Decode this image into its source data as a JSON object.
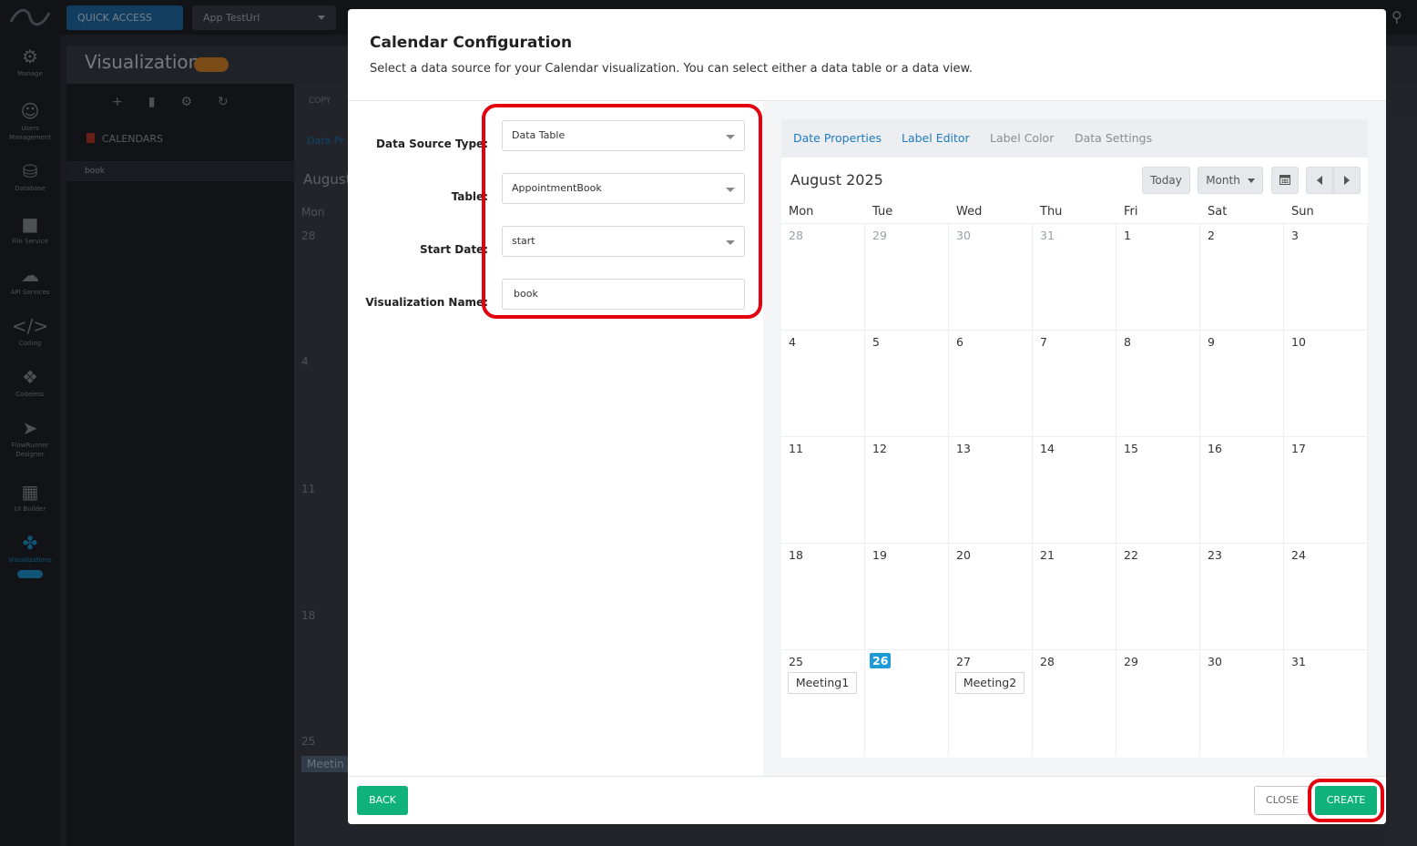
{
  "background": {
    "quick_access": "QUICK ACCESS",
    "app_selector": "App TestUrl",
    "header_title": "Visualizations",
    "tree_section": "CALENDARS",
    "tree_item": "book",
    "main_copy": "COPY",
    "main_tab": "Data Pr",
    "main_month": "August",
    "main_dow": "Mon",
    "main_days": [
      "28",
      "4",
      "11",
      "18",
      "25"
    ],
    "main_event": "Meetin",
    "rail": [
      {
        "icon": "gear-icon",
        "label": "Manage"
      },
      {
        "icon": "users-icon",
        "label": "Users Management"
      },
      {
        "icon": "database-icon",
        "label": "Database"
      },
      {
        "icon": "folder-icon",
        "label": "File Service"
      },
      {
        "icon": "cloud-icon",
        "label": "API Services"
      },
      {
        "icon": "code-icon",
        "label": "Coding"
      },
      {
        "icon": "puzzle-icon",
        "label": "Codeless"
      },
      {
        "icon": "flow-icon",
        "label": "FlowRunner Designer"
      },
      {
        "icon": "layout-icon",
        "label": "UI Builder"
      },
      {
        "icon": "visualizations-icon",
        "label": "Visualizations"
      }
    ]
  },
  "modal": {
    "title": "Calendar Configuration",
    "subtitle": "Select a data source for your Calendar visualization. You can select either a data table or a data view.",
    "form": {
      "data_source_type_label": "Data Source Type:",
      "data_source_type_value": "Data Table",
      "table_label": "Table:",
      "table_value": "AppointmentBook",
      "start_date_label": "Start Date:",
      "start_date_value": "start",
      "viz_name_label": "Visualization Name:",
      "viz_name_value": "book"
    },
    "tabs": [
      "Date Properties",
      "Label Editor",
      "Label Color",
      "Data Settings"
    ],
    "calendar": {
      "title": "August 2025",
      "today_label": "Today",
      "view_label": "Month",
      "weekdays": [
        "Mon",
        "Tue",
        "Wed",
        "Thu",
        "Fri",
        "Sat",
        "Sun"
      ],
      "weeks": [
        [
          "28",
          "29",
          "30",
          "31",
          "1",
          "2",
          "3"
        ],
        [
          "4",
          "5",
          "6",
          "7",
          "8",
          "9",
          "10"
        ],
        [
          "11",
          "12",
          "13",
          "14",
          "15",
          "16",
          "17"
        ],
        [
          "18",
          "19",
          "20",
          "21",
          "22",
          "23",
          "24"
        ],
        [
          "25",
          "26",
          "27",
          "28",
          "29",
          "30",
          "31"
        ]
      ],
      "today": "26",
      "events": [
        {
          "week": 4,
          "day": 0,
          "label": "Meeting1"
        },
        {
          "week": 4,
          "day": 2,
          "label": "Meeting2"
        }
      ]
    },
    "footer": {
      "back_label": "BACK",
      "close_label": "CLOSE",
      "create_label": "CREATE"
    }
  },
  "colors": {
    "accent": "#1e9bd7",
    "success": "#0eb27a",
    "highlight": "#e3000f"
  }
}
